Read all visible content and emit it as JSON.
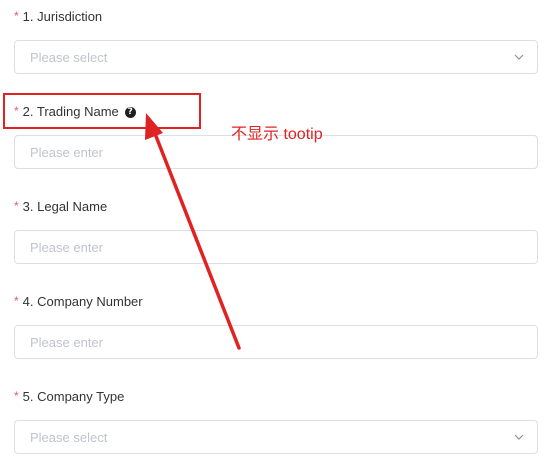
{
  "form": {
    "fields": [
      {
        "required_mark": "*",
        "label": "1. Jurisdiction",
        "placeholder": "Please select",
        "type": "select"
      },
      {
        "required_mark": "*",
        "label": "2. Trading Name",
        "placeholder": "Please enter",
        "type": "input",
        "help_icon": "question-circle-icon"
      },
      {
        "required_mark": "*",
        "label": "3. Legal Name",
        "placeholder": "Please enter",
        "type": "input"
      },
      {
        "required_mark": "*",
        "label": "4. Company Number",
        "placeholder": "Please enter",
        "type": "input"
      },
      {
        "required_mark": "*",
        "label": "5. Company Type",
        "placeholder": "Please select",
        "type": "select"
      }
    ]
  },
  "annotation": {
    "text": "不显示 tootip",
    "color": "#e02222"
  },
  "colors": {
    "required": "#e85a5a",
    "border": "#dcdfe6",
    "placeholder": "#c0c4cc",
    "label": "#333333"
  }
}
